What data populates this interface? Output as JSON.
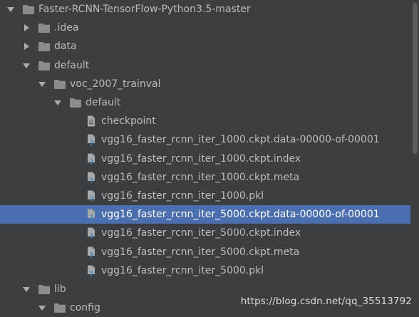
{
  "tree": {
    "items": [
      {
        "label": "Faster-RCNN-TensorFlow-Python3.5-master",
        "type": "folder",
        "depth": 0,
        "expanded": true
      },
      {
        "label": ".idea",
        "type": "folder",
        "depth": 1,
        "expanded": false
      },
      {
        "label": "data",
        "type": "folder",
        "depth": 1,
        "expanded": false
      },
      {
        "label": "default",
        "type": "folder",
        "depth": 1,
        "expanded": true
      },
      {
        "label": "voc_2007_trainval",
        "type": "folder",
        "depth": 2,
        "expanded": true
      },
      {
        "label": "default",
        "type": "folder",
        "depth": 3,
        "expanded": true
      },
      {
        "label": "checkpoint",
        "type": "text-file",
        "depth": 4
      },
      {
        "label": "vgg16_faster_rcnn_iter_1000.ckpt.data-00000-of-00001",
        "type": "unknown-file",
        "depth": 4
      },
      {
        "label": "vgg16_faster_rcnn_iter_1000.ckpt.index",
        "type": "unknown-file",
        "depth": 4
      },
      {
        "label": "vgg16_faster_rcnn_iter_1000.ckpt.meta",
        "type": "unknown-file",
        "depth": 4
      },
      {
        "label": "vgg16_faster_rcnn_iter_1000.pkl",
        "type": "unknown-file",
        "depth": 4
      },
      {
        "label": "vgg16_faster_rcnn_iter_5000.ckpt.data-00000-of-00001",
        "type": "unknown-file",
        "depth": 4,
        "selected": true
      },
      {
        "label": "vgg16_faster_rcnn_iter_5000.ckpt.index",
        "type": "unknown-file",
        "depth": 4
      },
      {
        "label": "vgg16_faster_rcnn_iter_5000.ckpt.meta",
        "type": "unknown-file",
        "depth": 4
      },
      {
        "label": "vgg16_faster_rcnn_iter_5000.pkl",
        "type": "unknown-file",
        "depth": 4
      },
      {
        "label": "lib",
        "type": "folder",
        "depth": 1,
        "expanded": true
      },
      {
        "label": "config",
        "type": "folder",
        "depth": 2,
        "expanded": true
      }
    ]
  },
  "watermark": "https://blog.csdn.net/qq_35513792",
  "colors": {
    "background": "#3c3f41",
    "selection": "#4b6eaf",
    "folder": "#8a8d90",
    "text": "#bbbbbb",
    "file_badge": "#4a90c8"
  }
}
